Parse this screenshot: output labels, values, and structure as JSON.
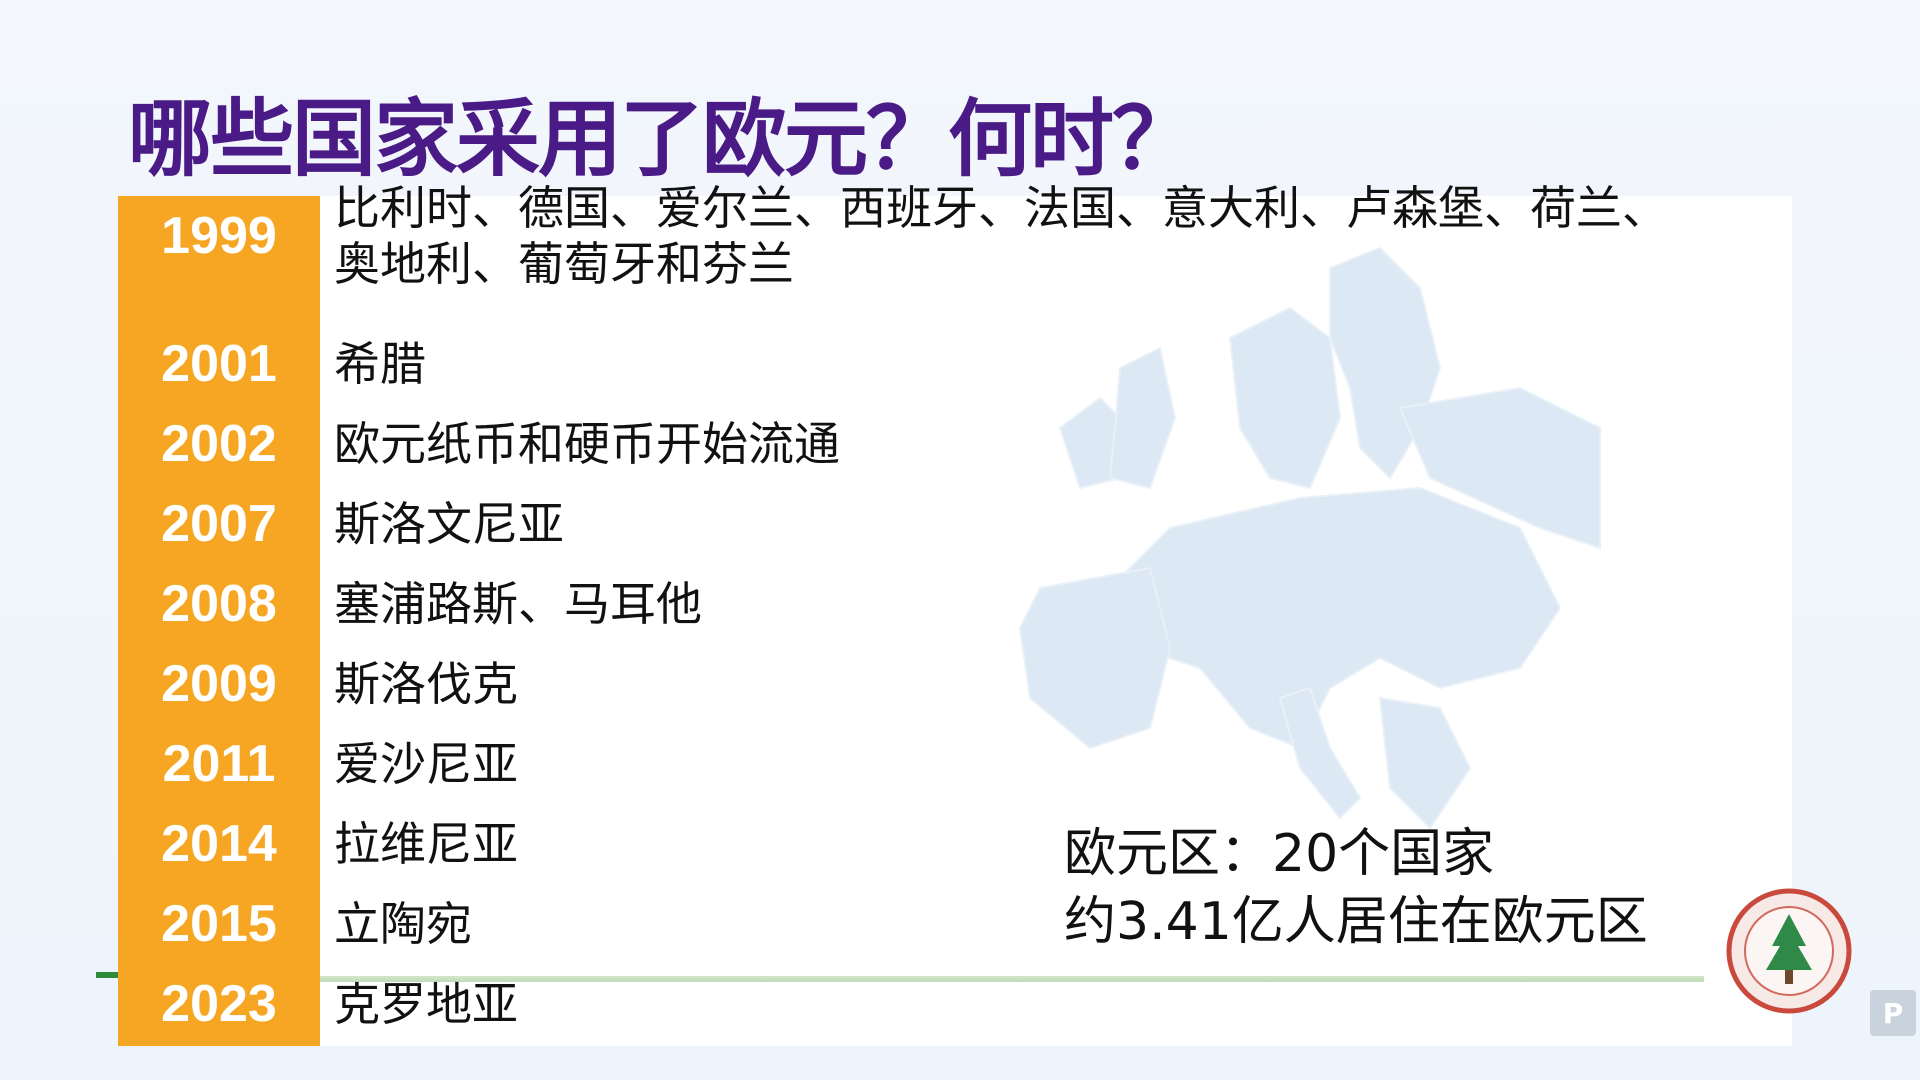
{
  "slide": {
    "title": "哪些国家采用了欧元？何时？",
    "accent_color": "#f6a623",
    "title_color": "#4a1a86"
  },
  "timeline": [
    {
      "year": "1999",
      "countries_line1": "比利时、德国、爱尔兰、西班牙、法国、意大利、卢森堡、荷兰、",
      "countries_line2": "奥地利、葡萄牙和芬兰"
    },
    {
      "year": "2001",
      "countries": "希腊"
    },
    {
      "year": "2002",
      "countries": "欧元纸币和硬币开始流通"
    },
    {
      "year": "2007",
      "countries": "斯洛文尼亚"
    },
    {
      "year": "2008",
      "countries": "塞浦路斯、马耳他"
    },
    {
      "year": "2009",
      "countries": "斯洛伐克"
    },
    {
      "year": "2011",
      "countries": "爱沙尼亚"
    },
    {
      "year": "2014",
      "countries": "拉维尼亚"
    },
    {
      "year": "2015",
      "countries": "立陶宛"
    },
    {
      "year": "2023",
      "countries": "克罗地亚"
    }
  ],
  "summary": {
    "line1": "欧元区：20个国家",
    "line2": "约3.41亿人居住在欧元区"
  },
  "icons": {
    "map": "europe-map-watermark",
    "emblem": "university-emblem",
    "corner": "app-badge-icon"
  },
  "corner_badge_glyph": "P"
}
